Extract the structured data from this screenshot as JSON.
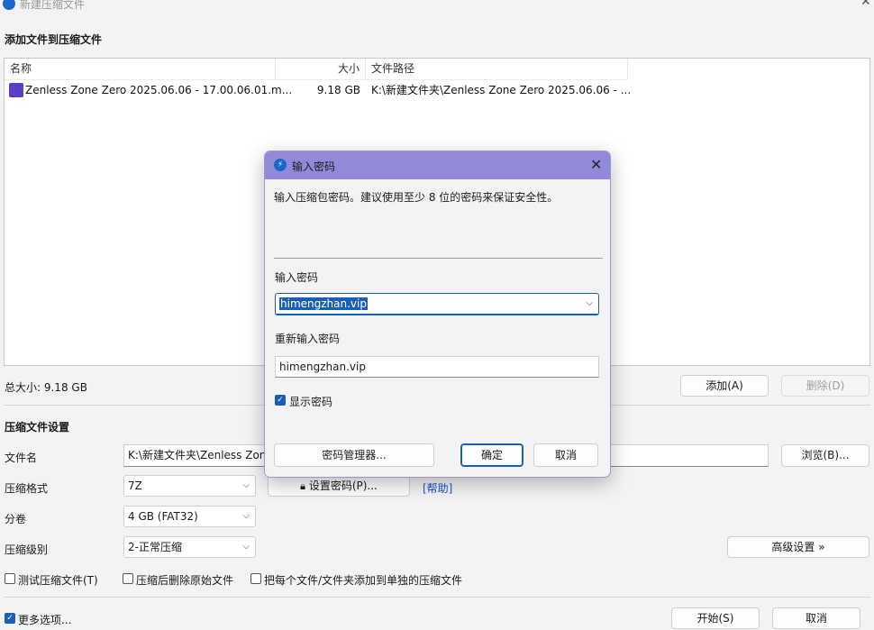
{
  "window": {
    "title": "新建压缩文件",
    "close": "✕"
  },
  "files": {
    "section_title": "添加文件到压缩文件",
    "columns": {
      "name": "名称",
      "size": "大小",
      "path": "文件路径"
    },
    "rows": [
      {
        "name": "Zenless Zone Zero 2025.06.06 - 17.00.06.01.m...",
        "size": "9.18 GB",
        "path": "K:\\新建文件夹\\Zenless Zone Zero 2025.06.06 - ...",
        "icon": "video-file-icon"
      }
    ],
    "total": "总大小: 9.18 GB",
    "add_button": "添加(A)",
    "remove_button": "删除(D)"
  },
  "settings": {
    "section_title": "压缩文件设置",
    "filename_label": "文件名",
    "filename_value": "K:\\新建文件夹\\Zenless Zone",
    "browse_button": "浏览(B)...",
    "format_label": "压缩格式",
    "format_value": "7Z",
    "set_password_button": "设置密码(P)...",
    "help_link": "[帮助]",
    "split_label": "分卷",
    "split_value": "4 GB (FAT32)",
    "level_label": "压缩级别",
    "level_value": "2-正常压缩",
    "advanced_button": "高级设置 »",
    "test_checkbox": "测试压缩文件(T)",
    "delete_checkbox": "压缩后删除原始文件",
    "separate_checkbox": "把每个文件/文件夹添加到单独的压缩文件",
    "more_options": "更多选项...",
    "start_button": "开始(S)",
    "cancel_button": "取消"
  },
  "dialog": {
    "title": "输入密码",
    "description": "输入压缩包密码。建议使用至少 8 位的密码来保证安全性。",
    "password_label": "输入密码",
    "password_value": "himengzhan.vip",
    "confirm_label": "重新输入密码",
    "confirm_value": "himengzhan.vip",
    "show_password": "显示密码",
    "show_password_checked": true,
    "manager_button": "密码管理器...",
    "ok_button": "确定",
    "cancel_button": "取消"
  },
  "colors": {
    "accent": "#1b5fb5",
    "dialog_title_bar": "#918ad8",
    "link": "#1b4fd8"
  }
}
